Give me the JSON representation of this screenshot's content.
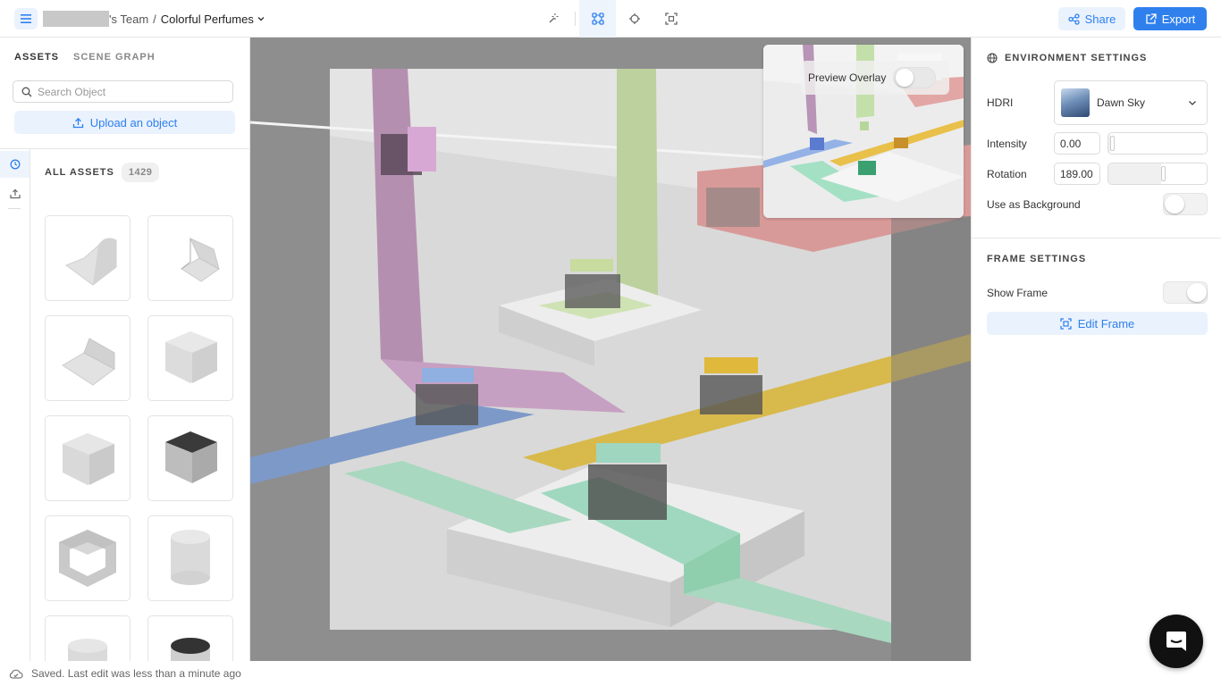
{
  "header": {
    "team": "'s Team",
    "separator": "/",
    "project": "Colorful Perfumes",
    "share_label": "Share",
    "export_label": "Export",
    "tools": [
      "magic-wand-icon",
      "move-nodes-icon",
      "target-icon",
      "frame-focus-icon"
    ],
    "active_tool": "move-nodes-icon",
    "accent_color": "#2f80ed"
  },
  "left_panel": {
    "tabs": {
      "assets": "ASSETS",
      "scene_graph": "SCENE GRAPH"
    },
    "active_tab": "ASSETS",
    "search": {
      "placeholder": "Search Object",
      "value": ""
    },
    "upload_label": "Upload an object",
    "all_assets_label": "ALL ASSETS",
    "all_assets_count": "1429",
    "assets": [
      {
        "shape": "curved-backdrop"
      },
      {
        "shape": "corner-backdrop"
      },
      {
        "shape": "bent-plane"
      },
      {
        "shape": "cube"
      },
      {
        "shape": "rounded-cube"
      },
      {
        "shape": "dark-cube"
      },
      {
        "shape": "glass-cube"
      },
      {
        "shape": "cylinder"
      },
      {
        "shape": "cylinder"
      },
      {
        "shape": "dark-cylinder"
      }
    ]
  },
  "viewport": {
    "preview_overlay_label": "Preview Overlay",
    "preview_overlay_on": false
  },
  "right_panel": {
    "environment_title": "ENVIRONMENT SETTINGS",
    "hdri_label": "HDRI",
    "hdri_value": "Dawn Sky",
    "intensity_label": "Intensity",
    "intensity_value": "0.00",
    "intensity_fraction": 0.0,
    "rotation_label": "Rotation",
    "rotation_value": "189.00",
    "rotation_fraction": 0.525,
    "use_as_background_label": "Use as Background",
    "use_as_background_on": false,
    "frame_title": "FRAME SETTINGS",
    "show_frame_label": "Show Frame",
    "show_frame_on": true,
    "edit_frame_label": "Edit Frame"
  },
  "status": {
    "text": "Saved. Last edit was less than a minute ago"
  }
}
